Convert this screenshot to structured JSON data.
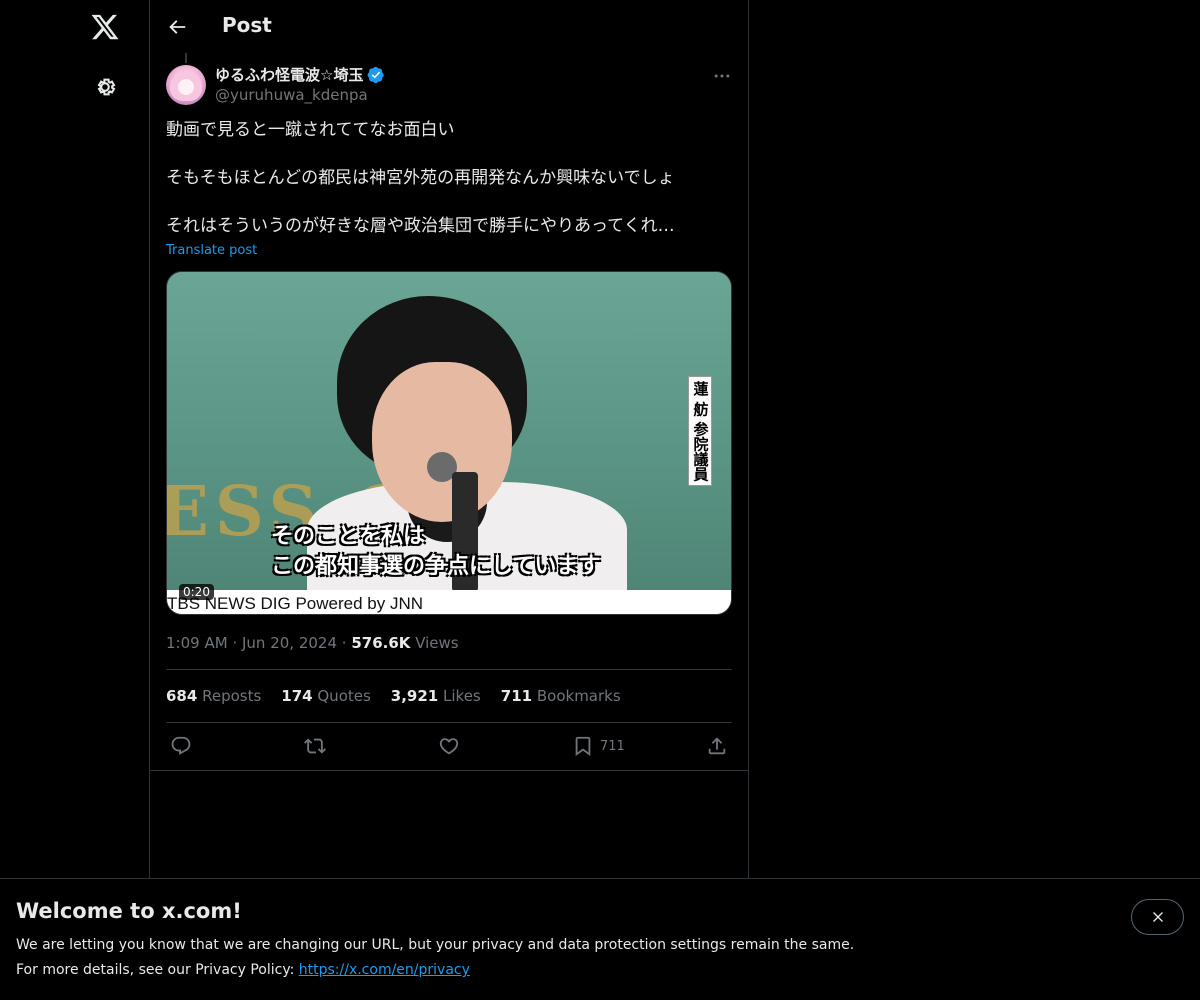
{
  "header": {
    "title": "Post"
  },
  "post": {
    "author": {
      "display_name": "ゆるふわ怪電波☆埼玉",
      "handle": "@yuruhuwa_kdenpa",
      "verified": true
    },
    "text": [
      "動画で見ると一蹴されててなお面白い",
      "そもそもほとんどの都民は神宮外苑の再開発なんか興味ないでしょ",
      "それはそういうのが好きな層や政治集団で勝手にやりあってくれ…"
    ],
    "translate_label": "Translate post",
    "media": {
      "duration": "0:20",
      "subtitle_line1": "そのことを私は",
      "subtitle_line2": "この都知事選の争点にしています",
      "name_card": "蓮 舫 参院議員",
      "footer": "TBS NEWS DIG Powered by JNN",
      "background_letters": "ESS CL"
    },
    "time": "1:09 AM",
    "date": "Jun 20, 2024",
    "views": "576.6K",
    "views_label": "Views",
    "stats": {
      "reposts": "684",
      "reposts_label": "Reposts",
      "quotes": "174",
      "quotes_label": "Quotes",
      "likes": "3,921",
      "likes_label": "Likes",
      "bookmarks": "711",
      "bookmarks_label": "Bookmarks"
    },
    "actions": {
      "bookmark_count": "711"
    }
  },
  "banner": {
    "title": "Welcome to x.com!",
    "line1": "We are letting you know that we are changing our URL, but your privacy and data protection settings remain the same.",
    "line2_prefix": "For more details, see our Privacy Policy: ",
    "link": "https://x.com/en/privacy"
  },
  "icons": {
    "logo": "x-logo-icon",
    "settings": "gear-icon",
    "back": "back-arrow-icon",
    "verified": "verified-badge-icon",
    "more": "more-dots-icon",
    "reply": "reply-icon",
    "repost": "repost-icon",
    "like": "heart-icon",
    "bookmark": "bookmark-icon",
    "share": "share-icon",
    "close": "close-icon"
  },
  "colors": {
    "accent": "#1d9bf0",
    "background": "#000000",
    "text": "#e7e9ea",
    "muted": "#71767b",
    "border": "#2f3336"
  }
}
